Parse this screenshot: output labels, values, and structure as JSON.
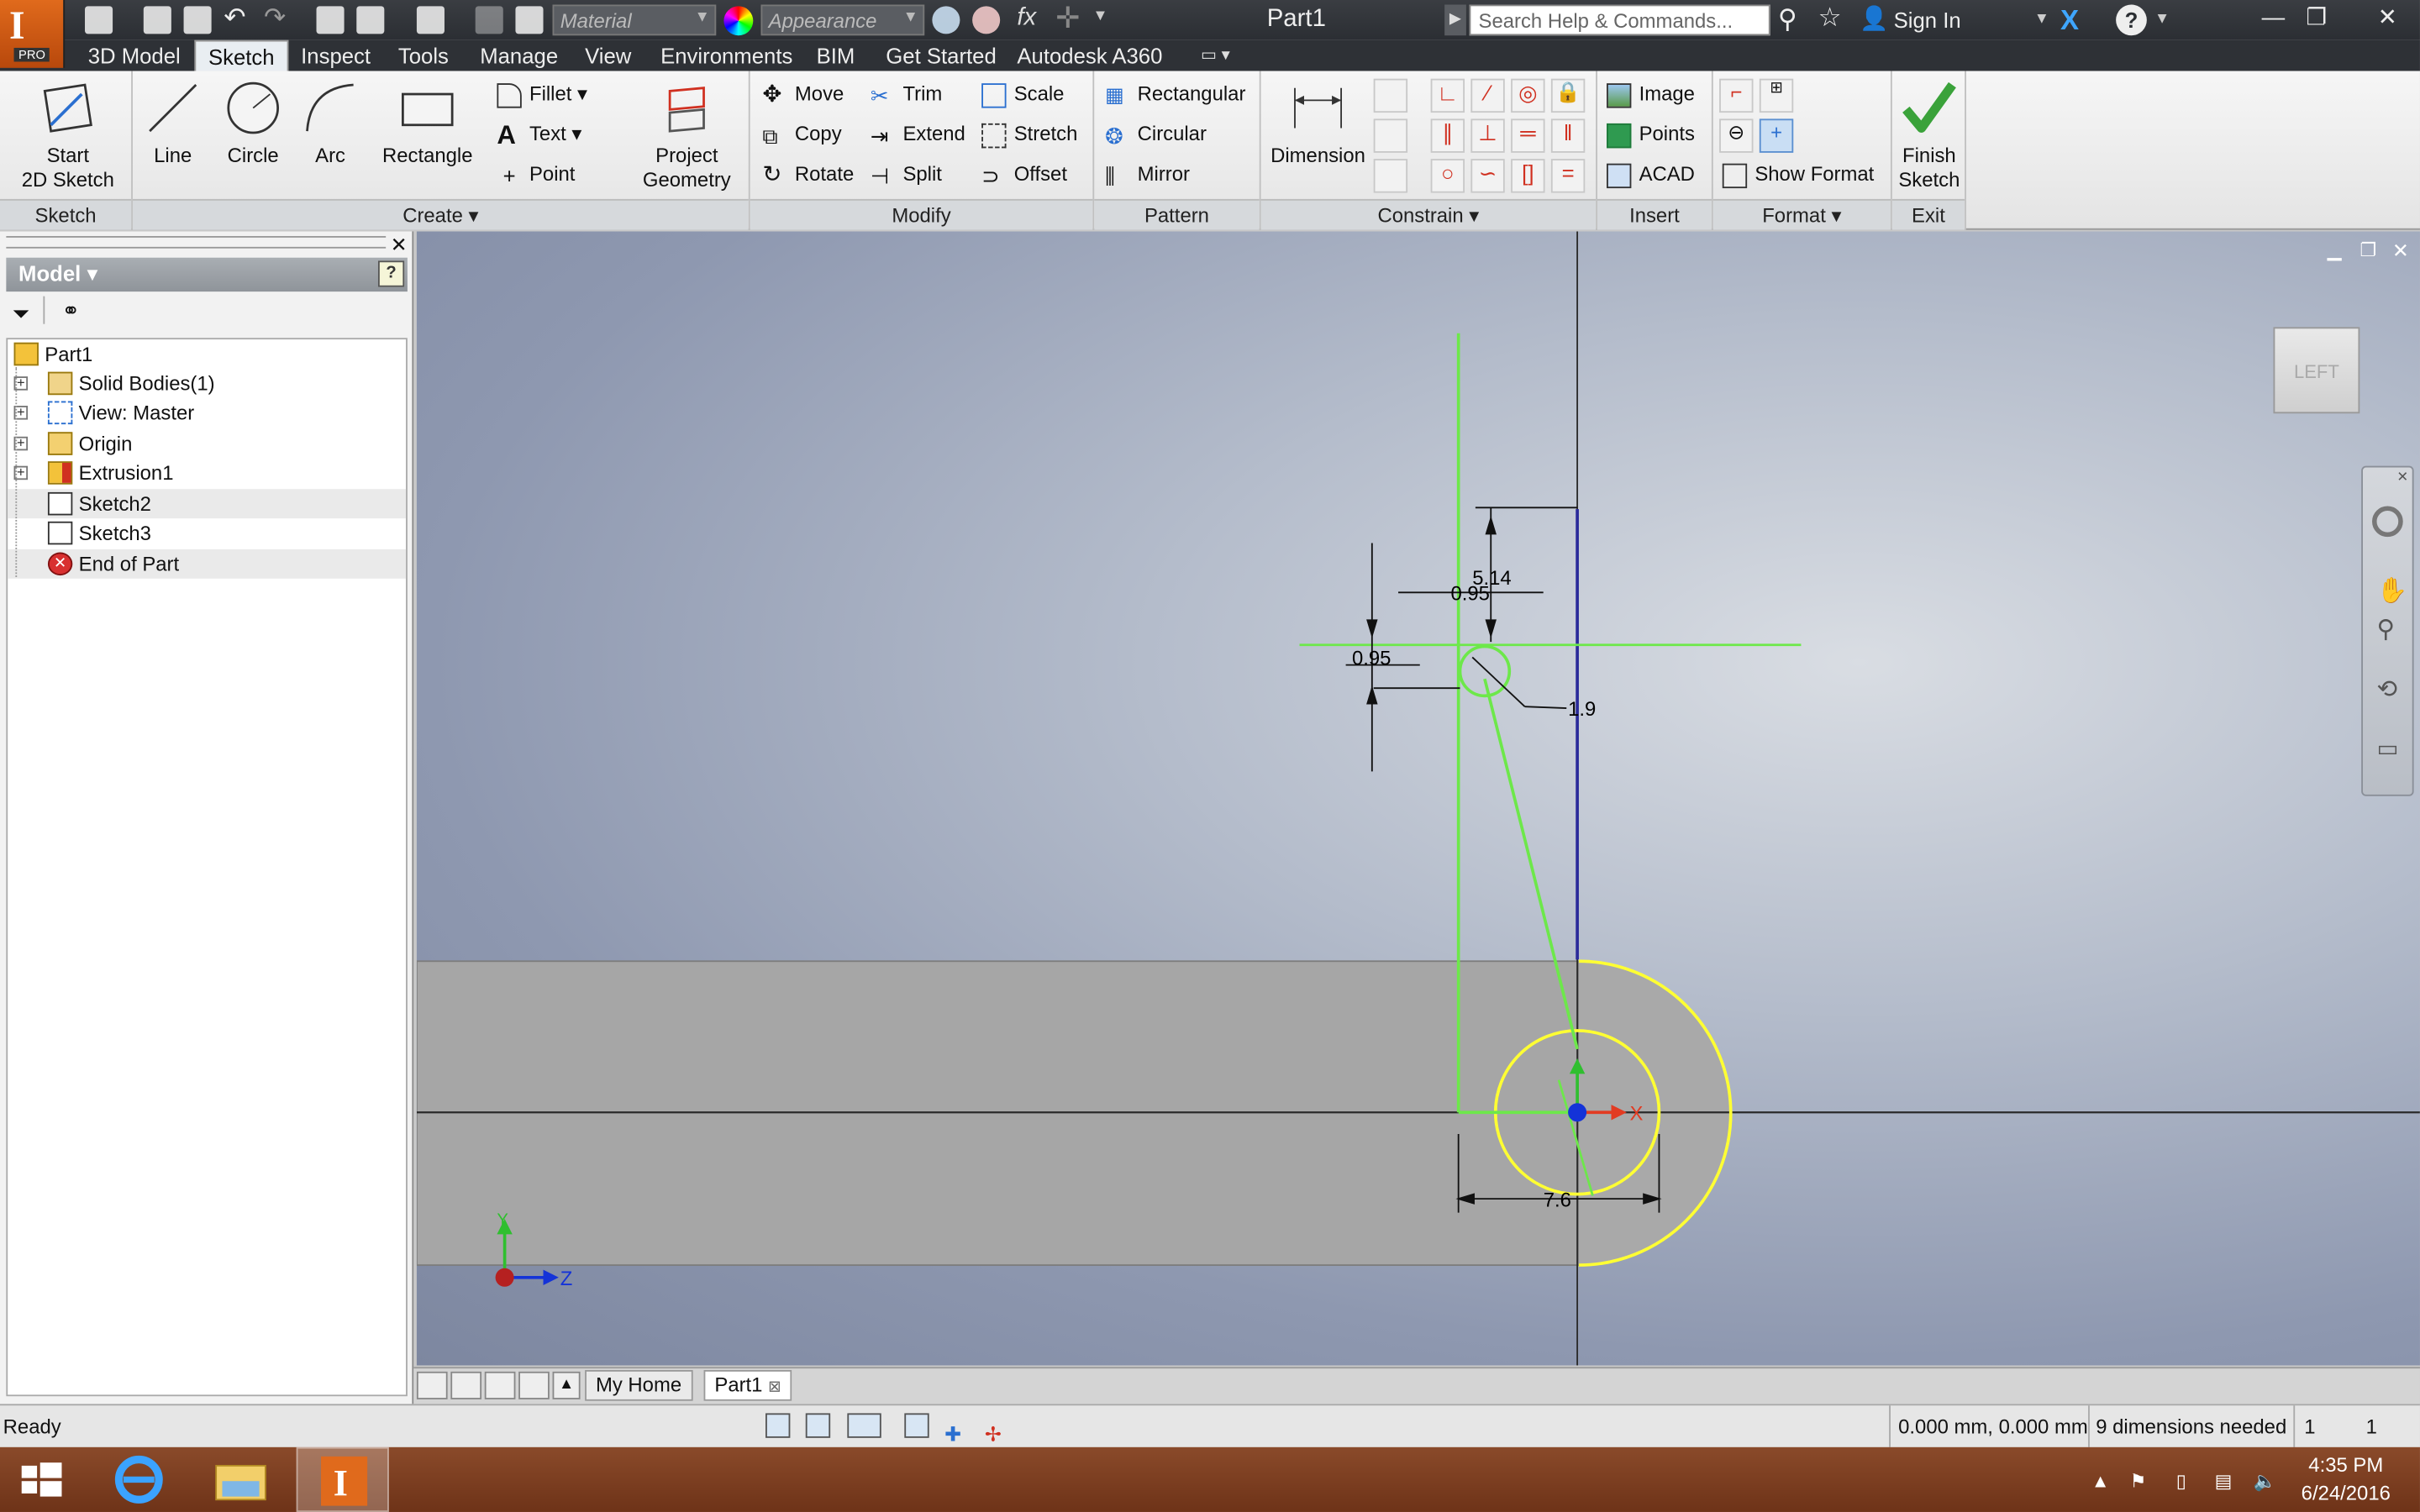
{
  "app": {
    "logo_letter": "I",
    "logo_edition": "PRO",
    "doc_title": "Part1"
  },
  "quickaccess": {
    "material_placeholder": "Material",
    "appearance_placeholder": "Appearance",
    "fx_label": "fx"
  },
  "search": {
    "placeholder": "Search Help & Commands..."
  },
  "account": {
    "signin_label": "Sign In",
    "help_label": "?"
  },
  "window": {
    "minimize": "—",
    "restore": "❐",
    "close": "✕"
  },
  "tabs": [
    "3D Model",
    "Sketch",
    "Inspect",
    "Tools",
    "Manage",
    "View",
    "Environments",
    "BIM",
    "Get Started",
    "Autodesk A360"
  ],
  "active_tab": "Sketch",
  "ribbon": {
    "sketch_panel": {
      "title": "Sketch",
      "start_label_1": "Start",
      "start_label_2": "2D Sketch"
    },
    "create_panel": {
      "title": "Create",
      "line": "Line",
      "circle": "Circle",
      "arc": "Arc",
      "rectangle": "Rectangle",
      "fillet": "Fillet",
      "text": "Text",
      "point": "Point",
      "project_1": "Project",
      "project_2": "Geometry"
    },
    "modify_panel": {
      "title": "Modify",
      "move": "Move",
      "copy": "Copy",
      "rotate": "Rotate",
      "trim": "Trim",
      "extend": "Extend",
      "split": "Split",
      "scale": "Scale",
      "stretch": "Stretch",
      "offset": "Offset"
    },
    "pattern_panel": {
      "title": "Pattern",
      "rectangular": "Rectangular",
      "circular": "Circular",
      "mirror": "Mirror"
    },
    "constrain_panel": {
      "title": "Constrain",
      "dimension": "Dimension"
    },
    "insert_panel": {
      "title": "Insert",
      "image": "Image",
      "points": "Points",
      "acad": "ACAD"
    },
    "format_panel": {
      "title": "Format",
      "show_format": "Show Format"
    },
    "exit_panel": {
      "title": "Exit",
      "finish_1": "Finish",
      "finish_2": "Sketch"
    }
  },
  "browser": {
    "title": "Model",
    "help": "?",
    "tree": [
      {
        "label": "Part1",
        "expandable": false
      },
      {
        "label": "Solid Bodies(1)",
        "expandable": true
      },
      {
        "label": "View: Master",
        "expandable": true
      },
      {
        "label": "Origin",
        "expandable": true
      },
      {
        "label": "Extrusion1",
        "expandable": true
      },
      {
        "label": "Sketch2",
        "expandable": false
      },
      {
        "label": "Sketch3",
        "expandable": false
      },
      {
        "label": "End of Part",
        "expandable": false
      }
    ]
  },
  "viewport": {
    "viewcube_label": "LEFT",
    "dims": {
      "d514": "5.14",
      "d095a": "0.95",
      "d095b": "0.95",
      "d19": "1.9",
      "d76": "7.6"
    },
    "axis_x": "X",
    "axis_z": "Z",
    "axis_y": "Y",
    "colors": {
      "sketch": "#6de84a",
      "projected": "#ffff33",
      "axis": "#2a2a2a",
      "x_axis": "#e23b22",
      "y_axis": "#2fbf2f",
      "origin": "#1433d8"
    }
  },
  "doc_tabs": {
    "home": "My Home",
    "part": "Part1"
  },
  "status": {
    "ready": "Ready",
    "coords": "0.000 mm, 0.000 mm",
    "dims_needed": "9 dimensions needed",
    "count1": "1",
    "count2": "1"
  },
  "taskbar": {
    "time": "4:35 PM",
    "date": "6/24/2016"
  }
}
